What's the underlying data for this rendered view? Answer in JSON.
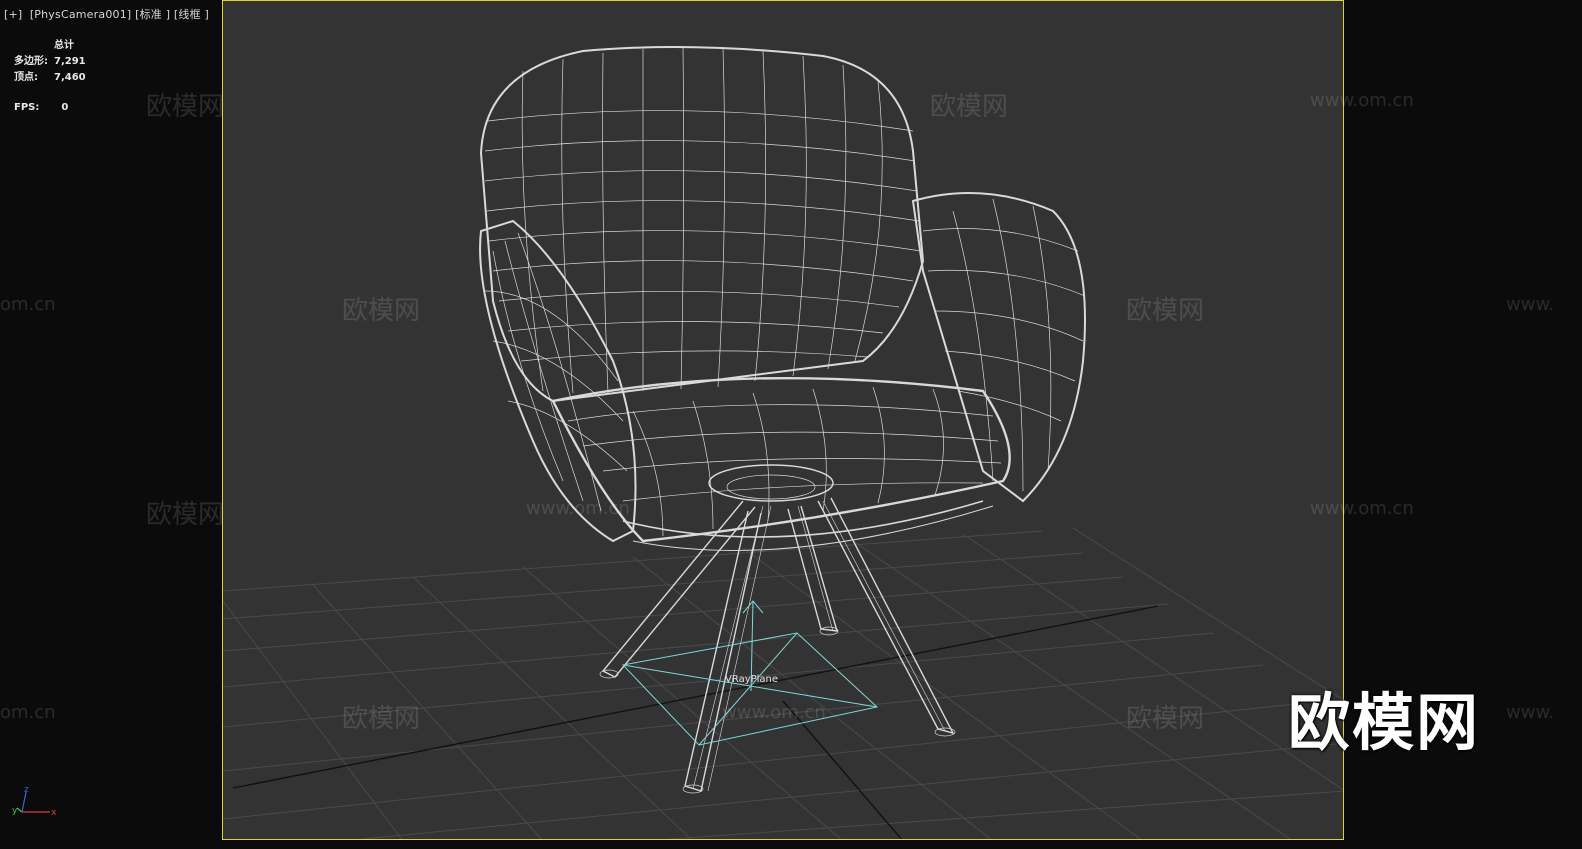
{
  "viewport": {
    "label_plus": "[+]",
    "label_camera": "[PhysCamera001]",
    "label_shading": "[标准 ]",
    "label_mode": "[线框 ]"
  },
  "stats": {
    "header": "总计",
    "polygons_label": "多边形:",
    "polygons_value": "7,291",
    "vertices_label": "顶点:",
    "vertices_value": "7,460",
    "fps_label": "FPS:",
    "fps_value": "0"
  },
  "scene": {
    "object_label": "VRayPlane",
    "wire_color": "#e8e8e8",
    "helper_color": "#7fd8d8",
    "grid_color": "#4a4a4a",
    "frame_color": "#d8d82a"
  },
  "axis": {
    "x": "x",
    "y": "y",
    "z": "z"
  },
  "watermarks": {
    "brand_cn": "欧模网",
    "url": "www.om.cn",
    "url_partial_left": "om.cn",
    "url_partial_right": "www.",
    "big": "欧模网"
  }
}
